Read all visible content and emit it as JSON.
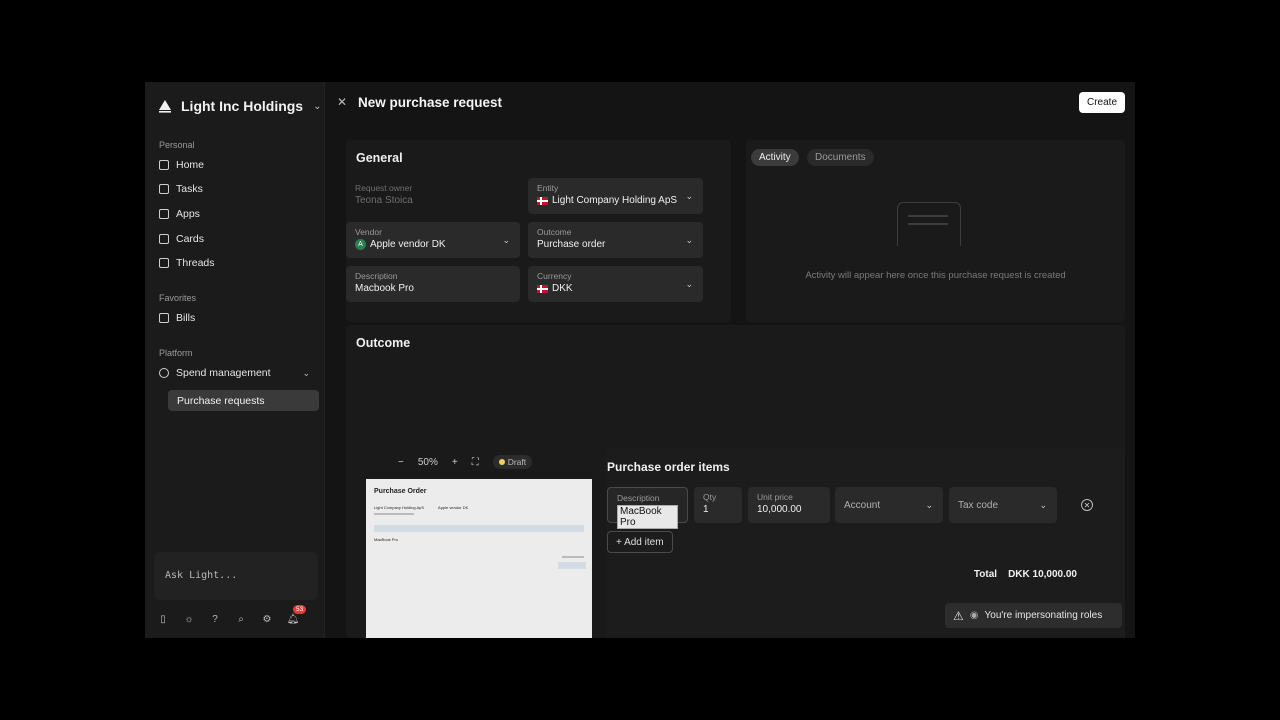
{
  "brand": {
    "name": "Light Inc Holdings"
  },
  "sidebar": {
    "personal_label": "Personal",
    "personal": [
      {
        "label": "Home",
        "icon": "home-icon"
      },
      {
        "label": "Tasks",
        "icon": "clipboard-icon"
      },
      {
        "label": "Apps",
        "icon": "grid-icon"
      },
      {
        "label": "Cards",
        "icon": "card-icon"
      },
      {
        "label": "Threads",
        "icon": "chat-icon"
      }
    ],
    "favorites_label": "Favorites",
    "favorites": [
      {
        "label": "Bills",
        "icon": "receipt-icon"
      }
    ],
    "platform_label": "Platform",
    "platform": [
      {
        "label": "Spend management",
        "icon": "refresh-icon"
      }
    ],
    "sub_items": [
      {
        "label": "Purchase requests",
        "active": true
      }
    ],
    "ask_placeholder": "Ask Light...",
    "notification_count": "53"
  },
  "header": {
    "title": "New purchase request",
    "create_label": "Create"
  },
  "general": {
    "title": "General",
    "request_owner": {
      "label": "Request owner",
      "value": "Teona Stoica"
    },
    "entity": {
      "label": "Entity",
      "value": "Light Company Holding ApS"
    },
    "vendor": {
      "label": "Vendor",
      "value": "Apple vendor DK",
      "avatar": "A"
    },
    "outcome": {
      "label": "Outcome",
      "value": "Purchase order"
    },
    "description": {
      "label": "Description",
      "value": "Macbook Pro"
    },
    "currency": {
      "label": "Currency",
      "value": "DKK"
    }
  },
  "activity": {
    "tabs": [
      "Activity",
      "Documents"
    ],
    "empty_text": "Activity will appear here once this purchase request is created"
  },
  "outcome_section": {
    "title": "Outcome",
    "zoom": "50%",
    "status": "Draft",
    "preview": {
      "title": "Purchase Order",
      "company": "Light Company Holding ApS",
      "vendor": "Apple vendor DK",
      "item": "MacBook Pro"
    }
  },
  "items": {
    "title": "Purchase order items",
    "row": {
      "description_label": "Description",
      "description": "MacBook Pro",
      "qty_label": "Qty",
      "qty": "1",
      "unit_price_label": "Unit price",
      "unit_price": "10,000.00",
      "account_placeholder": "Account",
      "tax_placeholder": "Tax code"
    },
    "add_label": "+ Add item",
    "total_label": "Total",
    "total_value": "DKK 10,000.00"
  },
  "toast": {
    "text": "You're impersonating roles"
  }
}
